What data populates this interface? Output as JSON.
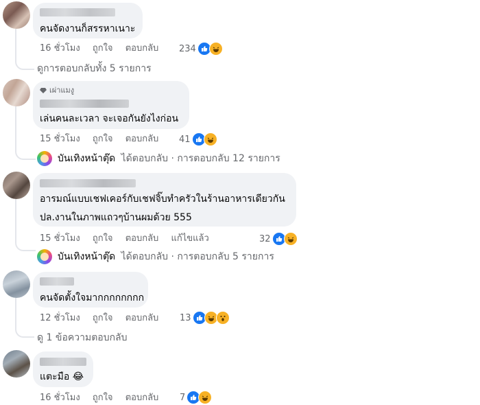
{
  "comments": [
    {
      "text": "คนจัดงานก็สรรหาเนาะ",
      "time": "16 ชั่วโมง",
      "like": "ถูกใจ",
      "reply": "ตอบกลับ",
      "reactions": "234",
      "view_replies": "ดูการตอบกลับทั้ง 5 รายการ"
    },
    {
      "badge": "เผ่าแมงู",
      "text": "เล่นคนละเวลา จะเจอกันยังไงก่อน",
      "time": "15 ชั่วโมง",
      "like": "ถูกใจ",
      "reply": "ตอบกลับ",
      "reactions": "41",
      "reply_author": "บันเทิงหน้าตุ๊ด",
      "reply_summary": "ได้ตอบกลับ · การตอบกลับ 12 รายการ"
    },
    {
      "text_line1": "อารมณ์แบบเชฟเคอร์กับเชฟจิ๊บทำครัวในร้านอาหารเดียวกัน",
      "text_line2": "ปล.งานในภาพแถวๆบ้านผมด้วย 555",
      "time": "15 ชั่วโมง",
      "like": "ถูกใจ",
      "reply": "ตอบกลับ",
      "edited": "แก้ไขแล้ว",
      "reactions": "32",
      "reply_author": "บันเทิงหน้าตุ๊ด",
      "reply_summary": "ได้ตอบกลับ · การตอบกลับ 5 รายการ"
    },
    {
      "text": "คนจัดตั้งใจมากกกกกกกก",
      "time": "12 ชั่วโมง",
      "like": "ถูกใจ",
      "reply": "ตอบกลับ",
      "reactions": "13",
      "view_replies": "ดู 1 ข้อความตอบกลับ"
    },
    {
      "text": "แตะมือ 😂",
      "time": "16 ชั่วโมง",
      "like": "ถูกใจ",
      "reply": "ตอบกลับ",
      "reactions": "7"
    }
  ]
}
